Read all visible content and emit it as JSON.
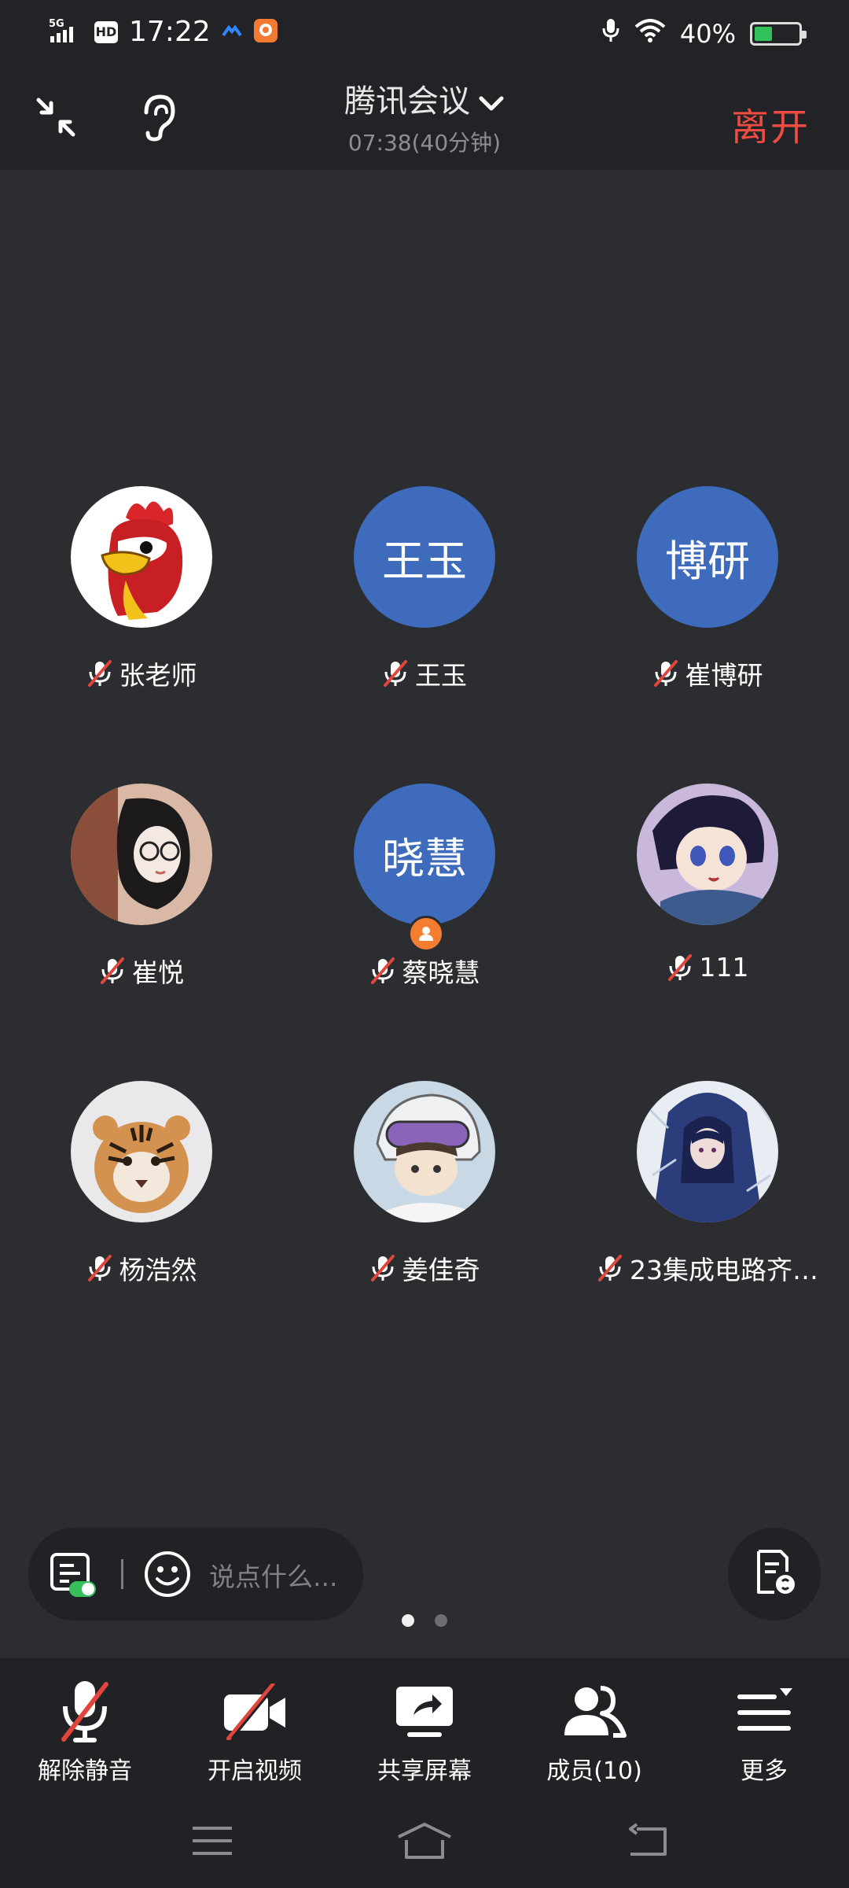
{
  "status_bar": {
    "network": "5G",
    "hd": "HD",
    "time": "17:22",
    "battery": "40%",
    "battery_level": 0.4
  },
  "header": {
    "title": "腾讯会议",
    "elapsed": "07:38(40分钟)",
    "leave_label": "离开"
  },
  "participants": [
    {
      "name": "张老师",
      "avatar_type": "image",
      "avatar_desc": "rooster-cartoon"
    },
    {
      "name": "王玉",
      "avatar_type": "text",
      "avatar_text": "王玉"
    },
    {
      "name": "崔博研",
      "avatar_type": "text",
      "avatar_text": "博研"
    },
    {
      "name": "崔悦",
      "avatar_type": "image",
      "avatar_desc": "girl-with-glasses"
    },
    {
      "name": "蔡晓慧",
      "avatar_type": "text",
      "avatar_text": "晓慧",
      "is_host": true
    },
    {
      "name": "111",
      "avatar_type": "image",
      "avatar_desc": "anime-boy"
    },
    {
      "name": "杨浩然",
      "avatar_type": "image",
      "avatar_desc": "tiger"
    },
    {
      "name": "姜佳奇",
      "avatar_type": "image",
      "avatar_desc": "anime-skier"
    },
    {
      "name": "23集成电路齐…",
      "avatar_type": "image",
      "avatar_desc": "anime-girl-winter"
    }
  ],
  "chat": {
    "placeholder": "说点什么..."
  },
  "pages": {
    "current": 1,
    "total": 2
  },
  "toolbar": [
    {
      "label": "解除静音",
      "icon": "mic-muted-icon"
    },
    {
      "label": "开启视频",
      "icon": "camera-off-icon"
    },
    {
      "label": "共享屏幕",
      "icon": "share-screen-icon"
    },
    {
      "label": "成员(10)",
      "icon": "members-icon"
    },
    {
      "label": "更多",
      "icon": "more-menu-icon"
    }
  ],
  "colors": {
    "background": "#2b2d31",
    "bar": "#222326",
    "leave": "#ee4b42",
    "avatar_blue": "#3f6bbd",
    "mute_red": "#e0463c",
    "host_orange": "#f57d30"
  }
}
